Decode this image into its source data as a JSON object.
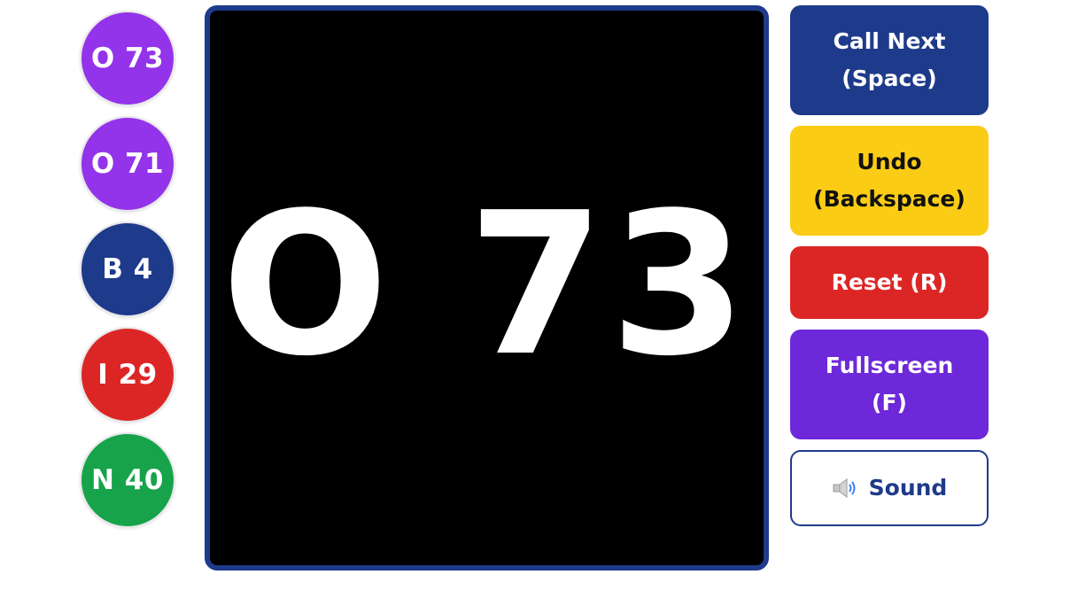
{
  "colors": {
    "purple_ball": "#9333ea",
    "blue_ball": "#1e3a8a",
    "red_ball": "#dc2626",
    "green_ball": "#16a34a",
    "display_border": "#1e3a8a",
    "call_button": "#1e3a8a",
    "undo_button": "#facc15",
    "reset_button": "#dc2626",
    "fullscreen_button": "#6d28d9"
  },
  "history": [
    {
      "label": "O 73",
      "color": "purple"
    },
    {
      "label": "O 71",
      "color": "purple"
    },
    {
      "label": "B 4",
      "color": "blue"
    },
    {
      "label": "I 29",
      "color": "red"
    },
    {
      "label": "N 40",
      "color": "green"
    }
  ],
  "display": {
    "current": "O 73"
  },
  "controls": {
    "call_next": "Call Next\n(Space)",
    "undo": "Undo\n(Backspace)",
    "reset": "Reset (R)",
    "fullscreen": "Fullscreen\n(F)",
    "sound": "Sound",
    "sound_icon": "speaker-icon"
  }
}
